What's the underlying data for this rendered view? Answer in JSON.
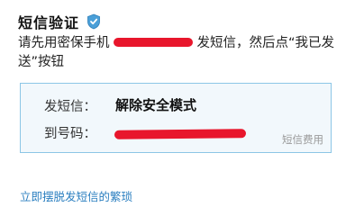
{
  "header": {
    "title": "短信验证",
    "shield_icon": "shield-check-icon",
    "shield_color": "#4a9fd8"
  },
  "instruction": {
    "before_number": "请先用密保手机",
    "after_number": "发短信，然后点“我已发送”按钮"
  },
  "sms_box": {
    "send_label": "发短信：",
    "sms_text": "解除安全模式",
    "to_label": "到号码：",
    "fee_note": "短信费用"
  },
  "footer": {
    "link_text": "立即摆脱发短信的繁琐"
  },
  "colors": {
    "redaction": "#e8162c",
    "box_border": "#8cc6e6",
    "box_background": "#f2f8fc",
    "link": "#2b7fc0"
  }
}
